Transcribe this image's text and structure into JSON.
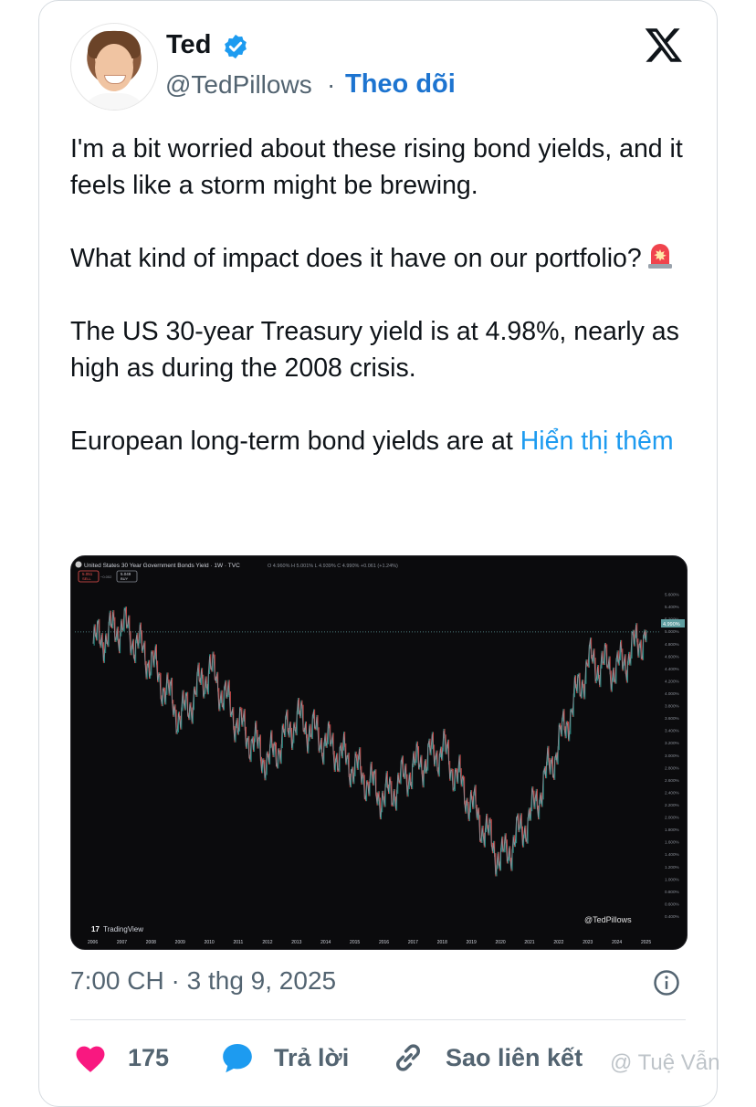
{
  "author": {
    "name": "Ted",
    "handle": "@TedPillows",
    "follow_label": "Theo dõi"
  },
  "tweet": {
    "paragraphs": [
      "I'm a bit worried about these rising bond yields, and it feels like a storm might be brewing.",
      "What kind of impact does it have on our portfolio?",
      "The US 30-year Treasury yield is at 4.98%, nearly as high as during the 2008 crisis.",
      "European long-term bond yields are at"
    ],
    "show_more_label": "Hiển thị thêm"
  },
  "chart": {
    "header": "United States 30 Year Government Bonds Yield · 1W · TVC",
    "ohlc": "O 4.960%  H 5.001%  L 4.939%  C 4.990%  +0.061 (+1.24%)",
    "sell_price": "5.051",
    "sell_label": "SELL",
    "spread": "−0.002",
    "buy_price": "5.049",
    "buy_label": "BUY",
    "current_label": "4.990%",
    "brand": "TradingView",
    "watermark": "@TedPillows",
    "accent_up": "#26a69a",
    "accent_down": "#ef5350",
    "current_color": "#5f9ea0"
  },
  "chart_data": {
    "type": "line",
    "title": "United States 30 Year Government Bonds Yield · 1W · TVC",
    "x": [
      "2006",
      "2007",
      "2008",
      "2009",
      "2010",
      "2011",
      "2012",
      "2013",
      "2014",
      "2015",
      "2016",
      "2017",
      "2018",
      "2019",
      "2020",
      "2021",
      "2022",
      "2023",
      "2024",
      "2025"
    ],
    "series": [
      {
        "values": [
          4.8,
          5.1,
          4.5,
          3.6,
          4.4,
          3.5,
          2.9,
          3.6,
          3.2,
          2.8,
          2.3,
          2.8,
          3.1,
          2.2,
          1.3,
          2.0,
          3.2,
          4.5,
          4.4,
          4.99
        ]
      }
    ],
    "ylim": [
      0.4,
      5.8
    ],
    "yticks": [
      "5.600%",
      "5.400%",
      "5.200%",
      "5.000%",
      "4.800%",
      "4.600%",
      "4.400%",
      "4.200%",
      "4.000%",
      "3.800%",
      "3.600%",
      "3.400%",
      "3.200%",
      "3.000%",
      "2.800%",
      "2.600%",
      "2.400%",
      "2.200%",
      "2.000%",
      "1.800%",
      "1.600%",
      "1.400%",
      "1.200%",
      "1.000%",
      "0.800%",
      "0.600%",
      "0.400%"
    ],
    "current_value": 4.99,
    "grid": false
  },
  "footer": {
    "time": "7:00 CH",
    "separator": "·",
    "date": "3 thg 9, 2025",
    "likes": "175",
    "reply_label": "Trả lời",
    "copy_link_label": "Sao liên kết",
    "watermark": "@ Tuệ Vẫn"
  },
  "colors": {
    "link": "#1d9bf0",
    "follow": "#1d74d0",
    "like": "#f91880",
    "reply": "#1d9bf0",
    "verified": "#1d9bf0"
  }
}
